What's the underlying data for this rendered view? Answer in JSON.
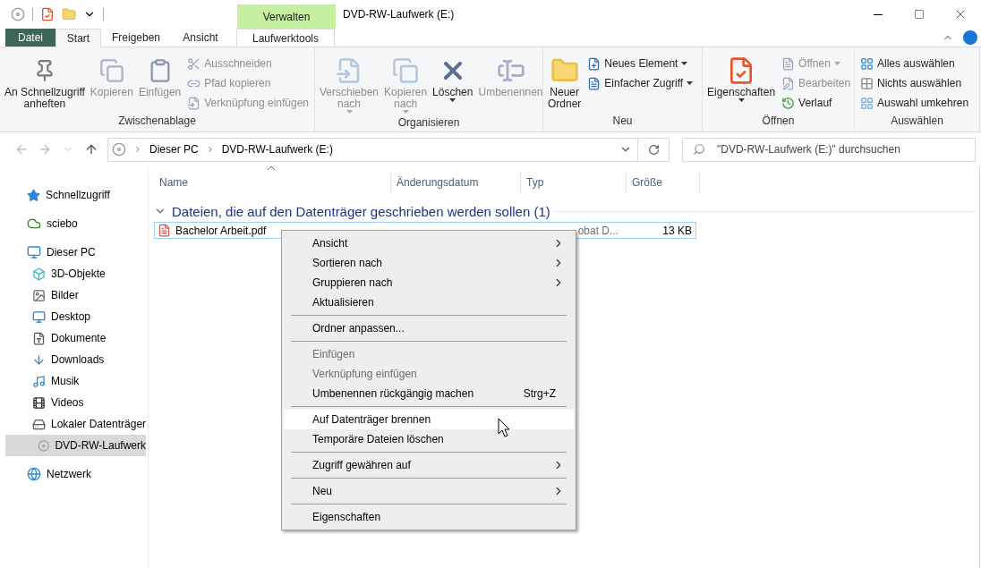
{
  "window": {
    "title": "DVD-RW-Laufwerk (E:)",
    "context_tab": "Verwalten"
  },
  "ribbon_tabs": [
    {
      "label": "Datei",
      "kind": "file",
      "selected": false
    },
    {
      "label": "Start",
      "kind": "tab",
      "selected": true
    },
    {
      "label": "Freigeben",
      "kind": "tab",
      "selected": false
    },
    {
      "label": "Ansicht",
      "kind": "tab",
      "selected": false
    },
    {
      "label": "Laufwerktools",
      "kind": "context",
      "selected": false
    }
  ],
  "ribbon_groups": [
    {
      "label": "Zwischenablage",
      "items": [
        {
          "kind": "large",
          "label": "An Schnellzugriff",
          "label2": "anheften",
          "disabled": false,
          "dropdown": false
        },
        {
          "kind": "large",
          "label": "Kopieren",
          "disabled": true,
          "dropdown": false
        },
        {
          "kind": "large",
          "label": "Einfügen",
          "disabled": true,
          "dropdown": false
        },
        {
          "kind": "stack",
          "items": [
            {
              "label": "Ausschneiden",
              "disabled": true,
              "dropdown": false
            },
            {
              "label": "Pfad kopieren",
              "disabled": true,
              "dropdown": false
            },
            {
              "label": "Verknüpfung einfügen",
              "disabled": true,
              "dropdown": false
            }
          ]
        }
      ]
    },
    {
      "label": "Organisieren",
      "items": [
        {
          "kind": "large",
          "label": "Verschieben",
          "label2": "nach",
          "disabled": true,
          "dropdown": true
        },
        {
          "kind": "large",
          "label": "Kopieren",
          "label2": "nach",
          "disabled": true,
          "dropdown": true
        },
        {
          "kind": "large",
          "label": "Löschen",
          "disabled": false,
          "dropdown": true
        },
        {
          "kind": "large",
          "label": "Umbenennen",
          "disabled": true,
          "dropdown": false
        }
      ]
    },
    {
      "label": "Neu",
      "items": [
        {
          "kind": "large",
          "label": "Neuer",
          "label2": "Ordner",
          "disabled": false,
          "dropdown": false
        },
        {
          "kind": "stack",
          "items": [
            {
              "label": "Neues Element",
              "disabled": false,
              "dropdown": true
            },
            {
              "label": "Einfacher Zugriff",
              "disabled": false,
              "dropdown": true
            }
          ]
        }
      ]
    },
    {
      "label": "Öffnen",
      "items": [
        {
          "kind": "large",
          "label": "Eigenschaften",
          "disabled": false,
          "dropdown": true
        },
        {
          "kind": "stack",
          "items": [
            {
              "label": "Öffnen",
              "disabled": true,
              "dropdown": true
            },
            {
              "label": "Bearbeiten",
              "disabled": true,
              "dropdown": false
            },
            {
              "label": "Verlauf",
              "disabled": false,
              "dropdown": false
            }
          ]
        }
      ]
    },
    {
      "label": "Auswählen",
      "items": [
        {
          "kind": "stack",
          "items": [
            {
              "label": "Alles auswählen",
              "disabled": false,
              "dropdown": false
            },
            {
              "label": "Nichts auswählen",
              "disabled": false,
              "dropdown": false
            },
            {
              "label": "Auswahl umkehren",
              "disabled": false,
              "dropdown": false
            }
          ]
        }
      ]
    }
  ],
  "address_bar": {
    "path": [
      "Dieser PC",
      "DVD-RW-Laufwerk (E:)"
    ]
  },
  "search": {
    "placeholder": "\"DVD-RW-Laufwerk (E:)\" durchsuchen"
  },
  "sidebar": {
    "items": [
      {
        "label": "Schnellzugriff",
        "selected": false
      },
      {
        "label": "sciebo",
        "selected": false
      },
      {
        "label": "Dieser PC",
        "selected": false,
        "children": [
          {
            "label": "3D-Objekte",
            "selected": false
          },
          {
            "label": "Bilder",
            "selected": false
          },
          {
            "label": "Desktop",
            "selected": false
          },
          {
            "label": "Dokumente",
            "selected": false
          },
          {
            "label": "Downloads",
            "selected": false
          },
          {
            "label": "Musik",
            "selected": false
          },
          {
            "label": "Videos",
            "selected": false
          },
          {
            "label": "Lokaler Datenträger",
            "selected": false
          },
          {
            "label": "DVD-RW-Laufwerk",
            "selected": true
          }
        ]
      },
      {
        "label": "Netzwerk",
        "selected": false
      }
    ]
  },
  "table": {
    "columns": [
      "Name",
      "Änderungsdatum",
      "Typ",
      "Größe"
    ],
    "group": {
      "label": "Dateien, die auf den Datenträger geschrieben werden sollen (1)",
      "expanded": true
    },
    "rows": [
      {
        "name": "Bachelor Arbeit.pdf",
        "type": "obat D...",
        "size": "13 KB",
        "selected": true
      }
    ]
  },
  "context_menu": {
    "items": [
      {
        "kind": "item",
        "label": "Ansicht",
        "submenu": true,
        "disabled": false,
        "selected": false
      },
      {
        "kind": "item",
        "label": "Sortieren nach",
        "submenu": true,
        "disabled": false,
        "selected": false
      },
      {
        "kind": "item",
        "label": "Gruppieren nach",
        "submenu": true,
        "disabled": false,
        "selected": false
      },
      {
        "kind": "item",
        "label": "Aktualisieren",
        "submenu": false,
        "disabled": false,
        "selected": false
      },
      {
        "kind": "separator"
      },
      {
        "kind": "item",
        "label": "Ordner anpassen...",
        "submenu": false,
        "disabled": false,
        "selected": false
      },
      {
        "kind": "separator"
      },
      {
        "kind": "item",
        "label": "Einfügen",
        "submenu": false,
        "disabled": true,
        "selected": false
      },
      {
        "kind": "item",
        "label": "Verknüpfung einfügen",
        "submenu": false,
        "disabled": true,
        "selected": false
      },
      {
        "kind": "item",
        "label": "Umbenennen rückgängig machen",
        "shortcut": "Strg+Z",
        "submenu": false,
        "disabled": false,
        "selected": false
      },
      {
        "kind": "separator"
      },
      {
        "kind": "item",
        "label": "Auf Datenträger brennen",
        "submenu": false,
        "disabled": false,
        "selected": true
      },
      {
        "kind": "item",
        "label": "Temporäre Dateien löschen",
        "submenu": false,
        "disabled": false,
        "selected": false
      },
      {
        "kind": "separator"
      },
      {
        "kind": "item",
        "label": "Zugriff gewähren auf",
        "submenu": true,
        "disabled": false,
        "selected": false
      },
      {
        "kind": "separator"
      },
      {
        "kind": "item",
        "label": "Neu",
        "submenu": true,
        "disabled": false,
        "selected": false
      },
      {
        "kind": "separator"
      },
      {
        "kind": "item",
        "label": "Eigenschaften",
        "submenu": false,
        "disabled": false,
        "selected": false
      }
    ]
  }
}
